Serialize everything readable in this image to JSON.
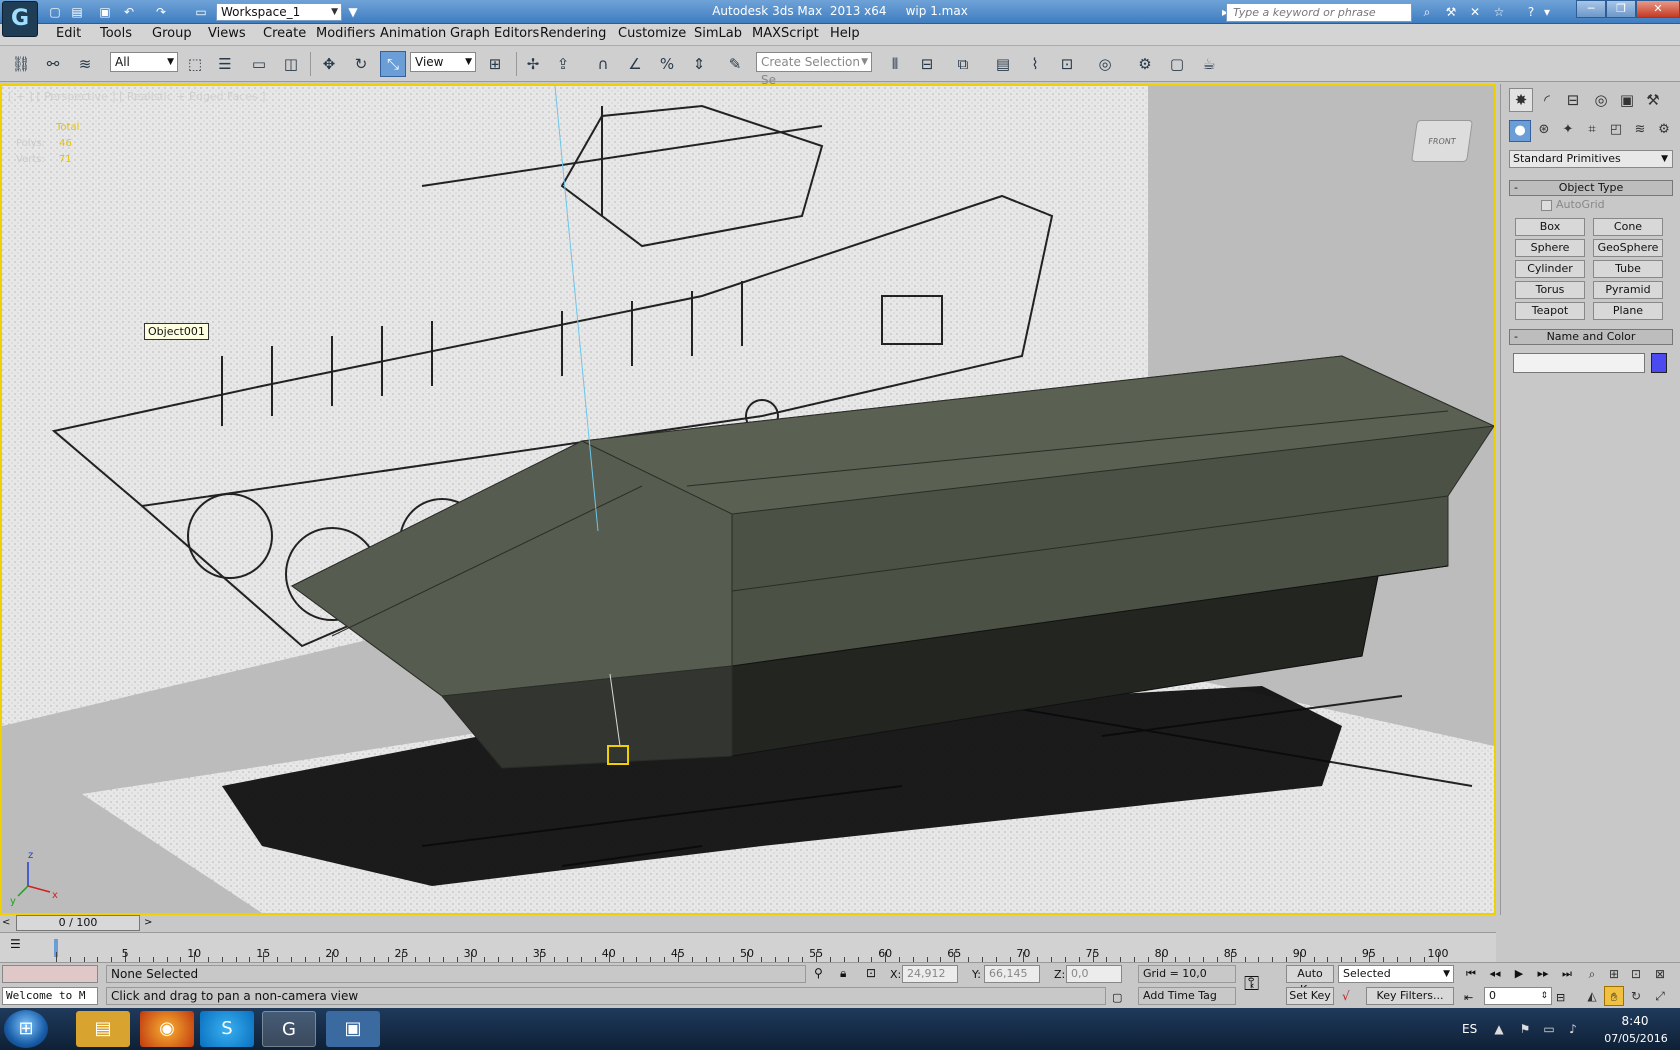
{
  "titlebar": {
    "workspace": "Workspace_1",
    "title": "Autodesk 3ds Max  2013 x64     wip 1.max",
    "search_placeholder": "Type a keyword or phrase"
  },
  "menu": [
    "Edit",
    "Tools",
    "Group",
    "Views",
    "Create",
    "Modifiers",
    "Animation",
    "Graph Editors",
    "Rendering",
    "Customize",
    "SimLab",
    "MAXScript",
    "Help"
  ],
  "toolbar": {
    "selection_filter": "All",
    "ref_coord": "View",
    "selection_set_placeholder": "Create Selection Se"
  },
  "viewport": {
    "label": "[ + ] [ Perspective ] [ Realistic + Edged Faces ]",
    "stats": [
      {
        "label": "Total",
        "value": ""
      },
      {
        "label": "Polys:",
        "value": "46"
      },
      {
        "label": "Verts:",
        "value": "71"
      }
    ],
    "object_tooltip": "Object001",
    "viewcube_face": "FRONT",
    "colors": {
      "model": "#4b5144",
      "border": "#f0d000",
      "background": "#bdbdbd"
    }
  },
  "command_panel": {
    "category": "Standard Primitives",
    "object_type_title": "Object Type",
    "autogrid_label": "AutoGrid",
    "primitives": [
      "Box",
      "Cone",
      "Sphere",
      "GeoSphere",
      "Cylinder",
      "Tube",
      "Torus",
      "Pyramid",
      "Teapot",
      "Plane"
    ],
    "name_color_title": "Name and Color",
    "object_color": "#4a4af0"
  },
  "timeline": {
    "thumb_label": "0 / 100",
    "ticks": [
      "5",
      "10",
      "15",
      "20",
      "25",
      "30",
      "35",
      "40",
      "45",
      "50",
      "55",
      "60",
      "65",
      "70",
      "75",
      "80",
      "85",
      "90",
      "95",
      "100"
    ]
  },
  "status": {
    "welcome": "Welcome to M",
    "selection": "None Selected",
    "prompt": "Click and drag to pan a non-camera view",
    "x_label": "X:",
    "x": "24,912",
    "y_label": "Y:",
    "y": "66,145",
    "z_label": "Z:",
    "z": "0,0",
    "grid": "Grid = 10,0",
    "add_time_tag": "Add Time Tag",
    "auto_key": "Auto Key",
    "set_key": "Set Key",
    "selected": "Selected",
    "key_filters": "Key Filters...",
    "frame": "0"
  },
  "taskbar": {
    "lang": "ES",
    "time": "8:40",
    "date": "07/05/2016"
  }
}
